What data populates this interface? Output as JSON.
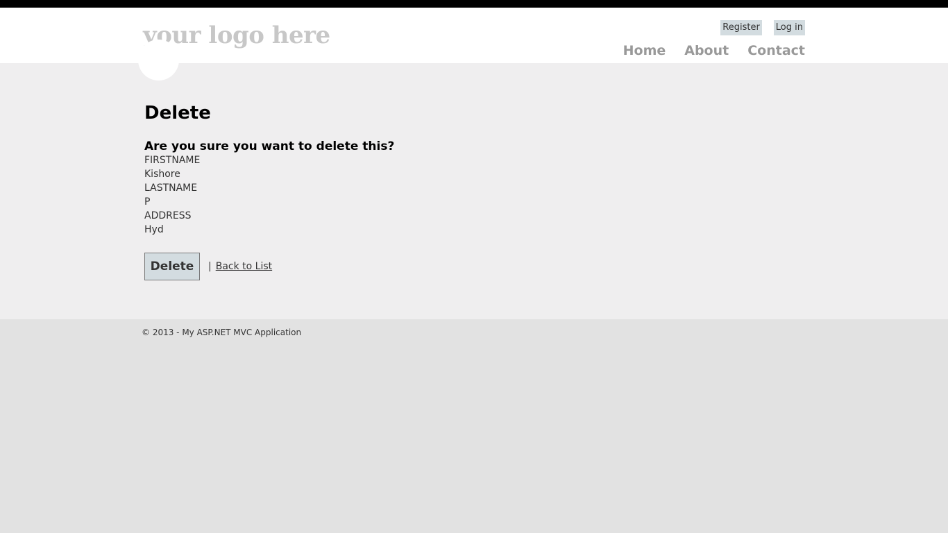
{
  "header": {
    "logo_text": "your logo here",
    "register_label": "Register",
    "login_label": "Log in",
    "nav": {
      "home": "Home",
      "about": "About",
      "contact": "Contact"
    }
  },
  "main": {
    "title": "Delete",
    "question": "Are you sure you want to delete this?",
    "fields": {
      "firstname_label": "FIRSTNAME",
      "firstname_value": "Kishore",
      "lastname_label": "LASTNAME",
      "lastname_value": "P",
      "address_label": "ADDRESS",
      "address_value": "Hyd"
    },
    "delete_button": "Delete",
    "separator": "|",
    "back_link": "Back to List"
  },
  "footer": {
    "copyright": "© 2013 - My ASP.NET MVC Application"
  },
  "colors": {
    "header_bg": "#ffffff",
    "body_bg": "#efeeef",
    "footer_bg": "#e2e2e2",
    "button_bg": "#d3dce0",
    "nav_text": "#999999"
  }
}
